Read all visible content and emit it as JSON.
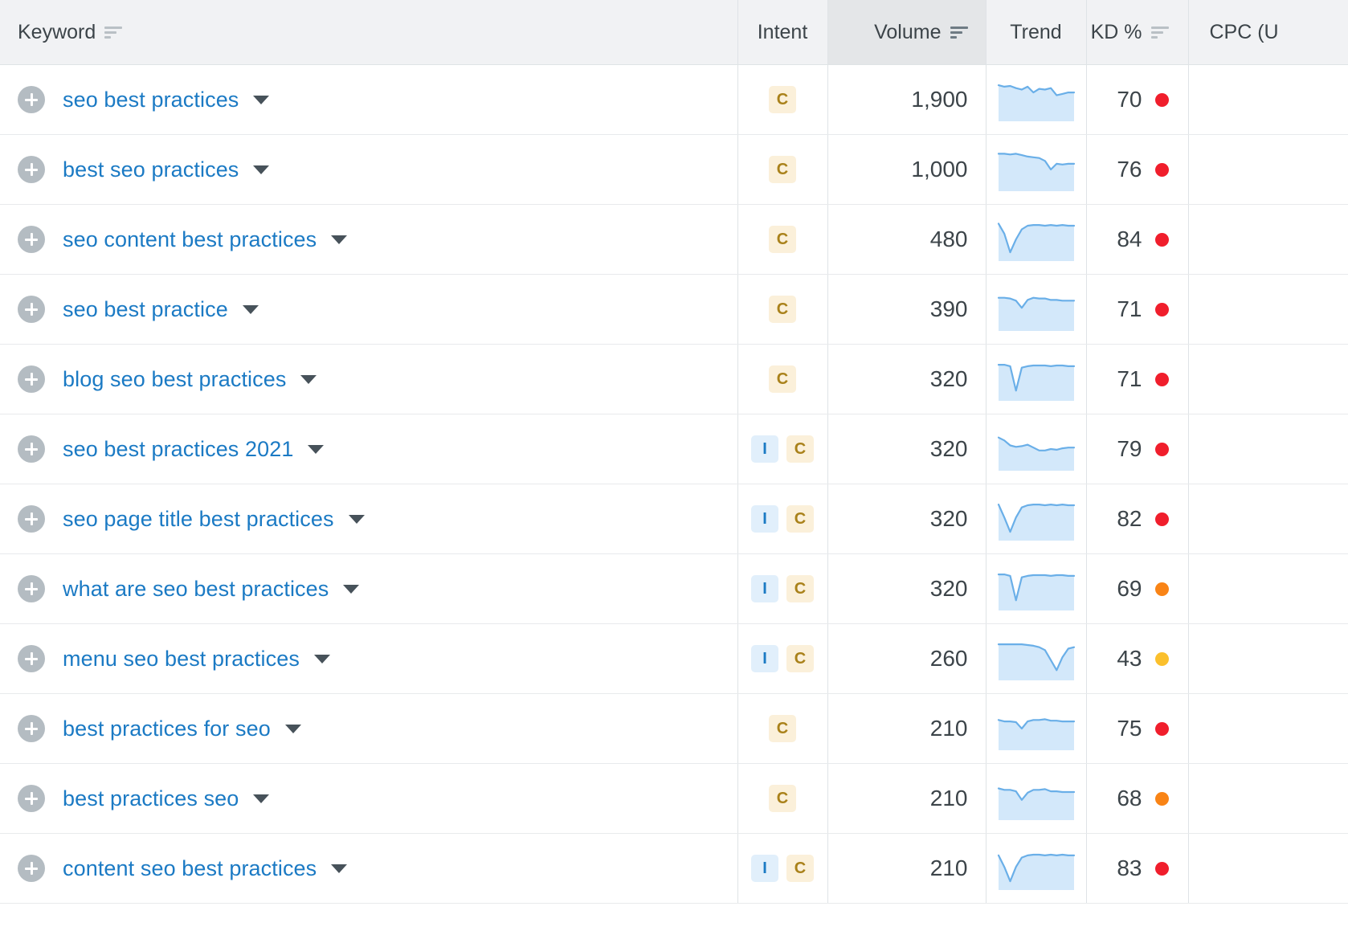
{
  "table": {
    "columns": [
      {
        "key": "keyword",
        "label": "Keyword",
        "sortable": true,
        "sort_active": false,
        "align": "left"
      },
      {
        "key": "intent",
        "label": "Intent",
        "sortable": false,
        "sort_active": false,
        "align": "center"
      },
      {
        "key": "volume",
        "label": "Volume",
        "sortable": true,
        "sort_active": true,
        "align": "right"
      },
      {
        "key": "trend",
        "label": "Trend",
        "sortable": false,
        "sort_active": false,
        "align": "center"
      },
      {
        "key": "kd",
        "label": "KD %",
        "sortable": true,
        "sort_active": false,
        "align": "right"
      },
      {
        "key": "cpc",
        "label": "CPC (U",
        "sortable": false,
        "sort_active": false,
        "align": "left"
      }
    ],
    "colors": {
      "link": "#1b7ac4",
      "header_bg": "#f1f2f4",
      "header_active_bg": "#e4e6e8",
      "badge_informational_bg": "#e1effb",
      "badge_informational_text": "#1b7ac4",
      "badge_commercial_bg": "#fbf0da",
      "badge_commercial_text": "#a9811a",
      "kd_red": "#f01e2c",
      "kd_orange": "#f98416",
      "kd_yellow": "#fbc02d",
      "sparkline_stroke": "#6aafe8",
      "sparkline_fill": "#d3e8fa",
      "add_button": "#b4bcc2"
    },
    "rows": [
      {
        "keyword": "seo best practices",
        "intent": [
          "C"
        ],
        "volume": "1,900",
        "kd": "70",
        "kd_color": "#f01e2c",
        "trend_points": [
          48,
          46,
          47,
          44,
          42,
          46,
          38,
          43,
          42,
          44,
          34,
          36,
          38,
          38
        ]
      },
      {
        "keyword": "best seo practices",
        "intent": [
          "C"
        ],
        "volume": "1,000",
        "kd": "76",
        "kd_color": "#f01e2c",
        "trend_points": [
          50,
          50,
          49,
          50,
          48,
          46,
          45,
          44,
          40,
          28,
          36,
          35,
          36,
          36
        ]
      },
      {
        "keyword": "seo content best practices",
        "intent": [
          "C"
        ],
        "volume": "480",
        "kd": "84",
        "kd_color": "#f01e2c",
        "trend_points": [
          50,
          36,
          10,
          28,
          42,
          47,
          48,
          48,
          47,
          48,
          47,
          48,
          47,
          47
        ]
      },
      {
        "keyword": "seo best practice",
        "intent": [
          "C"
        ],
        "volume": "390",
        "kd": "71",
        "kd_color": "#f01e2c",
        "trend_points": [
          44,
          44,
          43,
          40,
          30,
          41,
          44,
          43,
          43,
          41,
          41,
          40,
          40,
          40
        ]
      },
      {
        "keyword": "blog seo best practices",
        "intent": [
          "C"
        ],
        "volume": "320",
        "kd": "71",
        "kd_color": "#f01e2c",
        "trend_points": [
          48,
          48,
          46,
          12,
          44,
          46,
          47,
          47,
          47,
          46,
          47,
          47,
          46,
          46
        ]
      },
      {
        "keyword": "seo best practices 2021",
        "intent": [
          "I",
          "C"
        ],
        "volume": "320",
        "kd": "79",
        "kd_color": "#f01e2c",
        "trend_points": [
          44,
          40,
          33,
          31,
          32,
          34,
          30,
          26,
          26,
          28,
          27,
          29,
          30,
          30
        ]
      },
      {
        "keyword": "seo page title best practices",
        "intent": [
          "I",
          "C"
        ],
        "volume": "320",
        "kd": "82",
        "kd_color": "#f01e2c",
        "trend_points": [
          48,
          30,
          10,
          30,
          44,
          47,
          48,
          48,
          47,
          48,
          47,
          48,
          47,
          47
        ]
      },
      {
        "keyword": "what are seo best practices",
        "intent": [
          "I",
          "C"
        ],
        "volume": "320",
        "kd": "69",
        "kd_color": "#f98416",
        "trend_points": [
          48,
          48,
          46,
          12,
          44,
          46,
          47,
          47,
          47,
          46,
          47,
          47,
          46,
          46
        ]
      },
      {
        "keyword": "menu seo best practices",
        "intent": [
          "I",
          "C"
        ],
        "volume": "260",
        "kd": "43",
        "kd_color": "#fbc02d",
        "trend_points": [
          48,
          48,
          48,
          48,
          48,
          47,
          46,
          44,
          40,
          26,
          12,
          30,
          42,
          44
        ]
      },
      {
        "keyword": "best practices for seo",
        "intent": [
          "C"
        ],
        "volume": "210",
        "kd": "75",
        "kd_color": "#f01e2c",
        "trend_points": [
          40,
          38,
          38,
          37,
          28,
          38,
          40,
          40,
          41,
          39,
          39,
          38,
          38,
          38
        ]
      },
      {
        "keyword": "best practices seo",
        "intent": [
          "C"
        ],
        "volume": "210",
        "kd": "68",
        "kd_color": "#f98416",
        "trend_points": [
          42,
          40,
          40,
          38,
          26,
          36,
          40,
          40,
          41,
          38,
          38,
          37,
          37,
          37
        ]
      },
      {
        "keyword": "content seo best practices",
        "intent": [
          "I",
          "C"
        ],
        "volume": "210",
        "kd": "83",
        "kd_color": "#f01e2c",
        "trend_points": [
          46,
          30,
          10,
          30,
          43,
          46,
          47,
          47,
          46,
          47,
          46,
          47,
          46,
          46
        ]
      }
    ]
  }
}
